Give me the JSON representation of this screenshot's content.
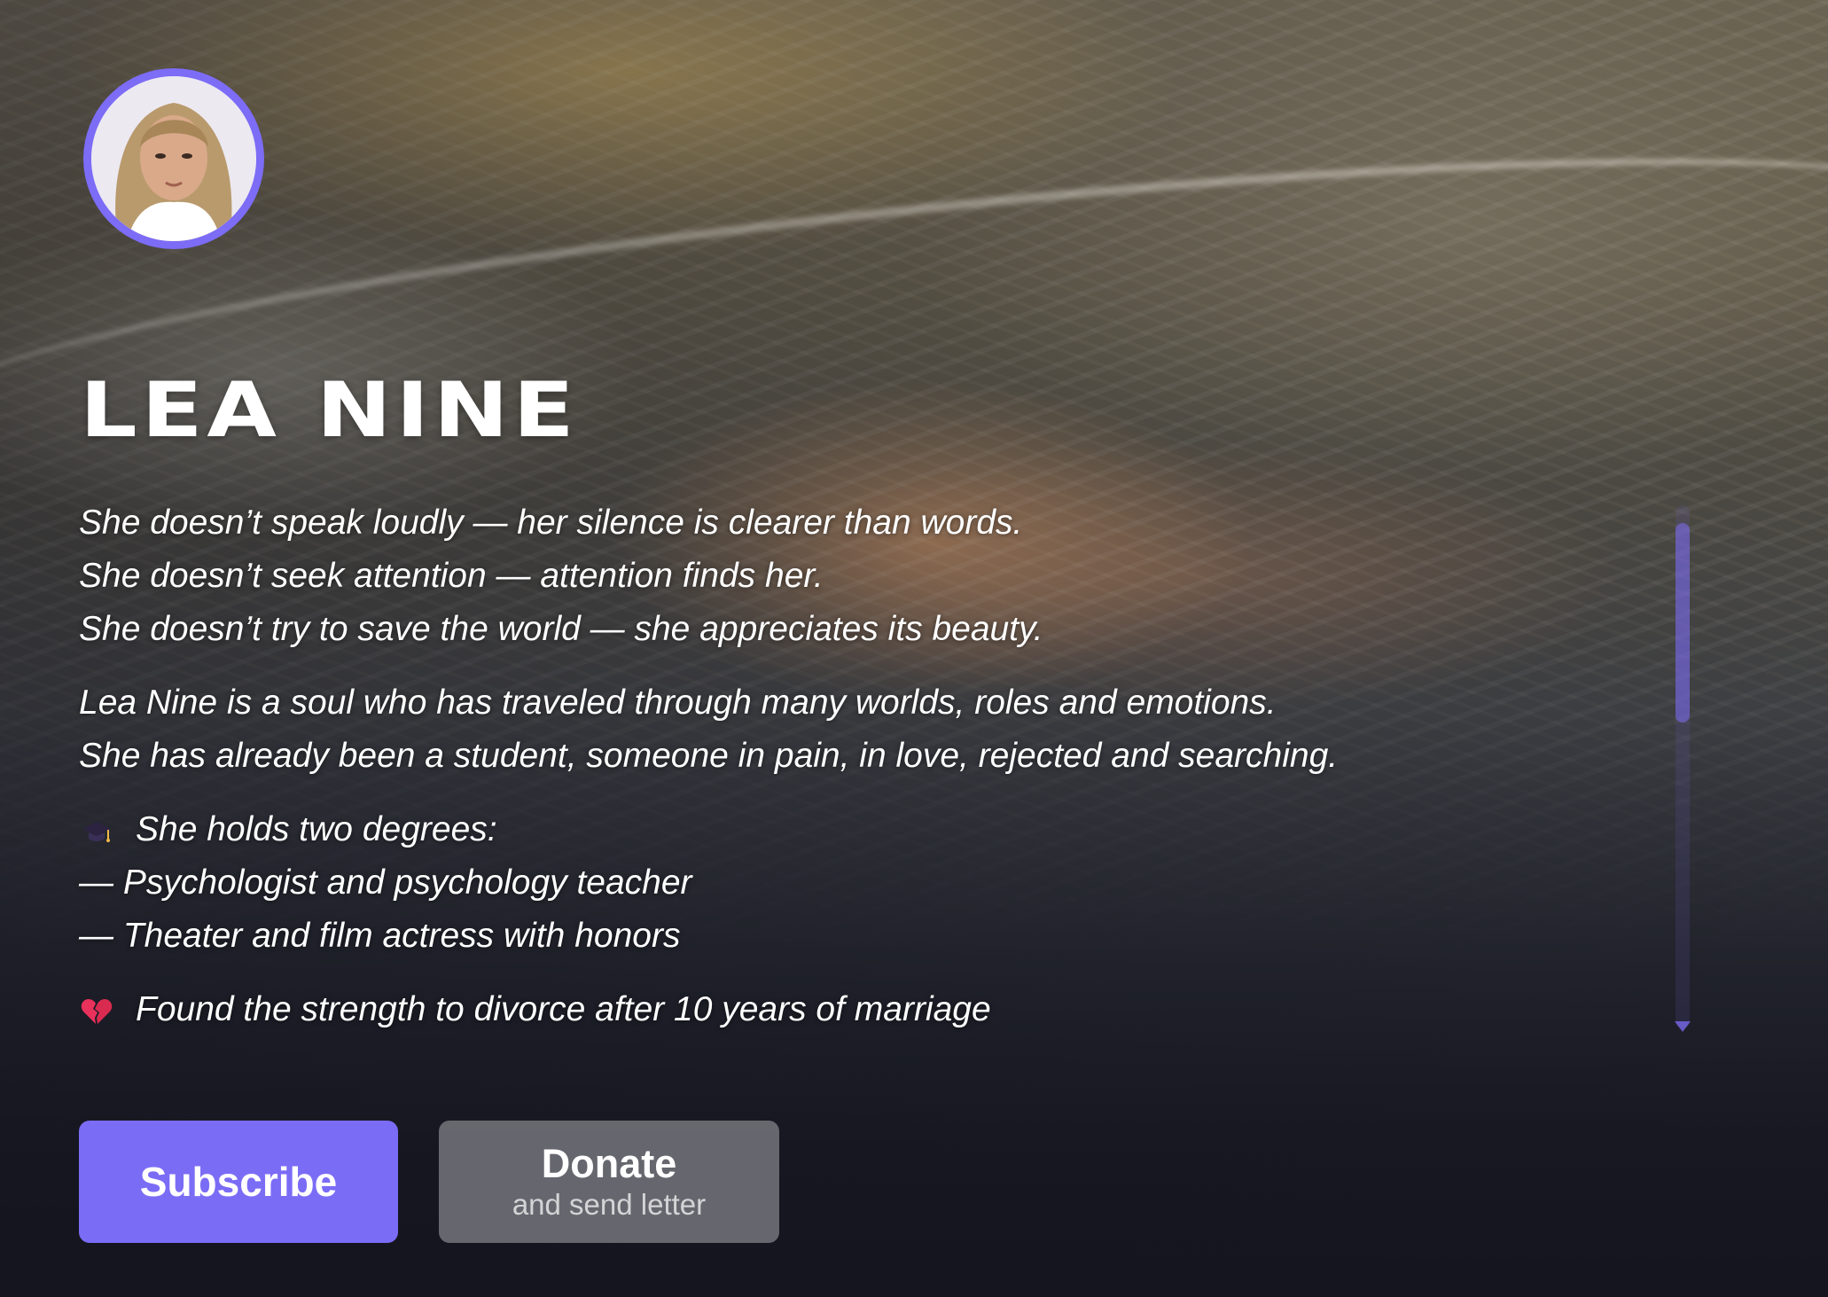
{
  "profile": {
    "name": "LEA NINE",
    "avatar_icon": "portrait-photo",
    "accent_color": "#7b6cf6"
  },
  "bio": {
    "paragraph1": [
      "She doesn’t speak loudly — her silence is clearer than words.",
      "She doesn’t seek attention — attention finds her.",
      "She doesn’t try to save the world — she appreciates its beauty."
    ],
    "paragraph2": [
      "Lea Nine is a soul who has traveled through many worlds, roles and emotions.",
      "She has already been a student, someone in pain, in love, rejected and searching."
    ],
    "degrees": {
      "icon": "graduation-cap-icon",
      "heading": "She holds two degrees:",
      "items": [
        "— Psychologist and psychology teacher",
        "— Theater and film actress with honors"
      ]
    },
    "divorce": {
      "icon": "broken-heart-icon",
      "text": "Found the strength to divorce after 10 years of marriage"
    }
  },
  "actions": {
    "subscribe_label": "Subscribe",
    "donate_label": "Donate",
    "donate_sublabel": "and send letter"
  }
}
